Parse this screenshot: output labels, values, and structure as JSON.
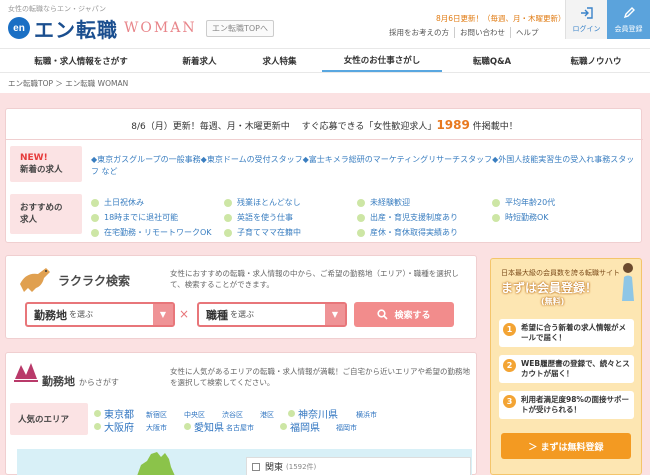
{
  "header": {
    "tagline": "女性の転職ならエン・ジャパン",
    "logo_en": "en",
    "logo_name": "エン転職",
    "logo_woman": "WOMAN",
    "top_link": "エン転職TOPへ",
    "update_note": "8月6日更新！（毎週、月・木曜更新）",
    "util_links": [
      "採用をお考えの方",
      "お問い合わせ",
      "ヘルプ"
    ],
    "login_label": "ログイン",
    "register_label": "会員登録"
  },
  "nav": {
    "tabs": [
      "転職・求人情報をさがす",
      "新着求人",
      "求人特集",
      "女性のお仕事さがし",
      "転職Q&A",
      "転職ノウハウ"
    ]
  },
  "breadcrumb": "エン転職TOP ＞ エン転職 WOMAN",
  "news": {
    "headline_pre": "8/6（月）更新！毎週、月・木曜更新中　 すぐ応募できる「女性歓迎求人」",
    "headline_count": "1989",
    "headline_post": " 件掲載中！",
    "new_label_top": "NEW!",
    "new_label": "新着の求人",
    "new_text": "◆東京ガスグループの一般事務◆東京ドームの受付スタッフ◆富士キメラ総研のマーケティングリサーチスタッフ◆外国人技能実習生の受入れ事務スタッフ など",
    "rec_label": "おすすめの求人",
    "rec_items": [
      "土日祝休み",
      "残業ほとんどなし",
      "未経験歓迎",
      "平均年齢20代",
      "18時までに退社可能",
      "英語を使う仕事",
      "出産・育児支援制度あり",
      "時短勤務OK",
      "在宅勤務・リモートワークOK",
      "子育てママ在籍中",
      "産休・育休取得実績あり"
    ]
  },
  "search": {
    "title": "ラクラク検索",
    "desc": "女性におすすめの転職・求人情報の中から、ご希望の勤務地（エリア）・職種を選択して、検索することができます。",
    "location_label": "勤務地",
    "location_hint": "を選ぶ",
    "job_label": "職種",
    "job_hint": "を選ぶ",
    "times": "×",
    "button": "検索する"
  },
  "area": {
    "title": "勤務地",
    "title_suffix": "からさがす",
    "desc": "女性に人気があるエリアの転職・求人情報が満載！ご自宅から近いエリアや希望の勤務地を選択して検索してください。",
    "popular_label": "人気のエリア",
    "prefs": [
      "東京都",
      "神奈川県",
      "大阪府",
      "愛知県",
      "福岡県"
    ],
    "cities": [
      "新宿区",
      "中央区",
      "渋谷区",
      "港区",
      "横浜市",
      "大阪市",
      "名古屋市",
      "福岡市"
    ],
    "kanto_label": "関東",
    "kanto_count": "(1592件)"
  },
  "sidebar": {
    "top": "日本最大級の会員数を誇る転職サイト",
    "title": "まずは会員登録！",
    "sub": "(無料)",
    "items": [
      "希望に合う新着の求人情報がメールで届く！",
      "WEB履歴書の登録で、続々とスカウトが届く！",
      "利用者満足度98%の面接サポートが受けられる！"
    ],
    "nums": [
      "1",
      "2",
      "3"
    ],
    "button": "＞ まずは無料登録"
  }
}
